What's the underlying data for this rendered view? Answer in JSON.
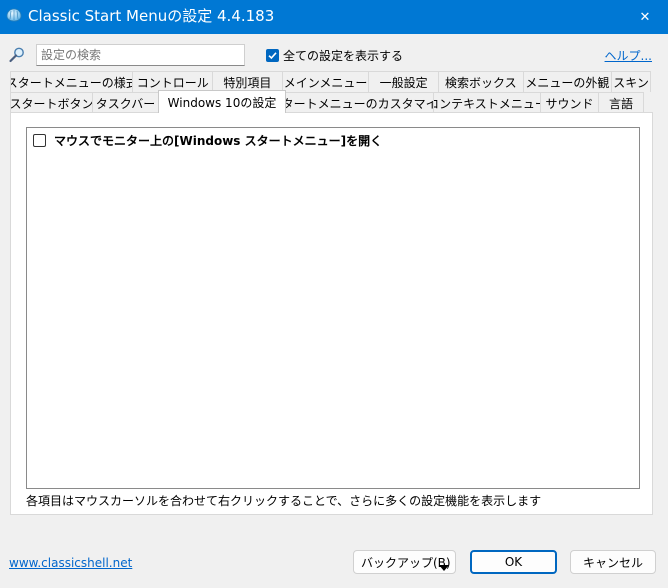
{
  "window": {
    "title": "Classic Start Menuの設定 4.4.183",
    "close_glyph": "✕"
  },
  "toolbar": {
    "search_placeholder": "設定の検索",
    "show_all_label": "全ての設定を表示する",
    "show_all_checked": true,
    "help_label": "ヘルプ..."
  },
  "tabs": {
    "row1": [
      "スタートメニューの様式",
      "コントロール",
      "特別項目",
      "メインメニュー",
      "一般設定",
      "検索ボックス",
      "メニューの外観",
      "スキン"
    ],
    "row2": [
      "スタートボタン",
      "タスクバー",
      "Windows 10の設定",
      "スタートメニューのカスタマイズ",
      "コンテキストメニュー",
      "サウンド",
      "言語"
    ],
    "active": "Windows 10の設定"
  },
  "settings": {
    "items": [
      {
        "label": "マウスでモニター上の[Windows スタートメニュー]を開く",
        "checked": false
      }
    ],
    "hint": "各項目はマウスカーソルを合わせて右クリックすることで、さらに多くの設定機能を表示します"
  },
  "footer": {
    "website": "www.classicshell.net",
    "backup_label": "バックアップ(B)",
    "ok_label": "OK",
    "cancel_label": "キャンセル"
  },
  "colors": {
    "titlebar": "#0078d4",
    "accent": "#0067c0",
    "link": "#0066cc"
  },
  "icons": {
    "app": "shell-icon",
    "search": "magnifier-icon",
    "close": "close-icon",
    "dropdown": "chevron-down-icon"
  }
}
